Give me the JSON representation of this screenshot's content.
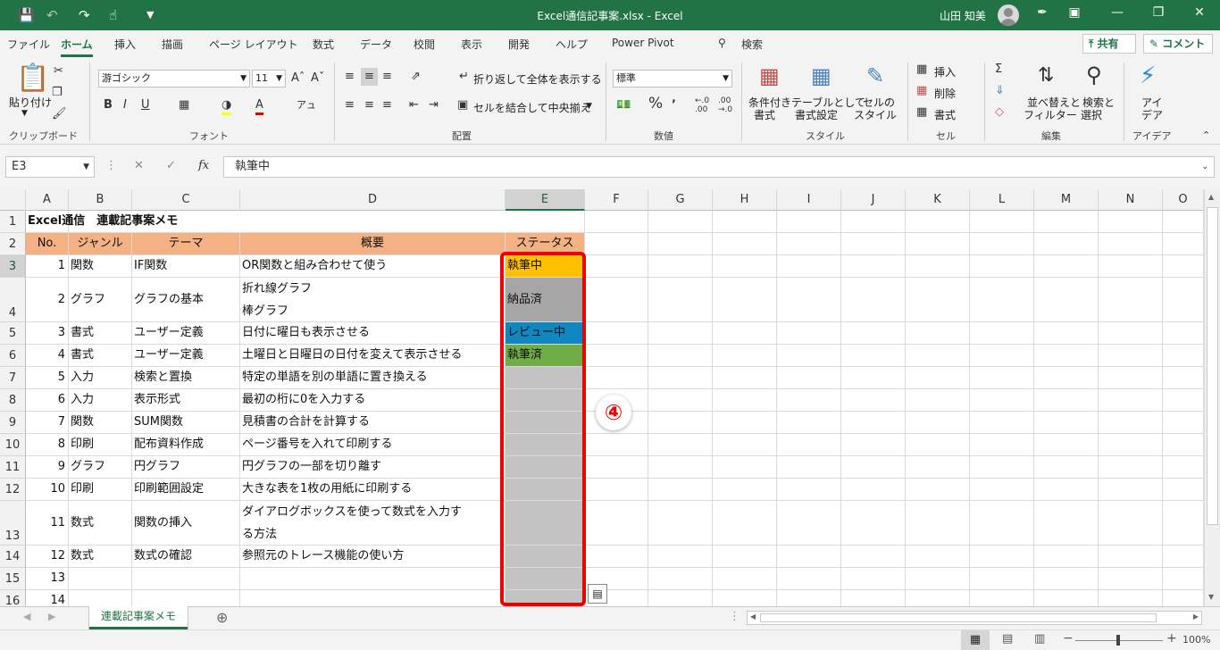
{
  "titlebar": {
    "title": "Excel通信記事案.xlsx  -  Excel",
    "user": "山田 知美"
  },
  "menu": {
    "tabs": [
      "ファイル",
      "ホーム",
      "挿入",
      "描画",
      "ページ レイアウト",
      "数式",
      "データ",
      "校閲",
      "表示",
      "開発",
      "ヘルプ",
      "Power Pivot"
    ],
    "search": "検索",
    "share": "共有",
    "comment": "コメント"
  },
  "ribbon": {
    "clipboard": {
      "paste": "貼り付け",
      "label": "クリップボード"
    },
    "font": {
      "name": "游ゴシック",
      "size": "11",
      "label": "フォント"
    },
    "align": {
      "wrap": "折り返して全体を表示する",
      "merge": "セルを結合して中央揃え",
      "label": "配置"
    },
    "number": {
      "format": "標準",
      "label": "数値"
    },
    "styles": {
      "cond1": "条件付き",
      "cond2": "書式",
      "table1": "テーブルとして",
      "table2": "書式設定",
      "cell1": "セルの",
      "cell2": "スタイル",
      "label": "スタイル"
    },
    "cells": {
      "insert": "挿入",
      "delete": "削除",
      "format": "書式",
      "label": "セル"
    },
    "edit": {
      "sort1": "並べ替えと",
      "sort2": "フィルター",
      "find1": "検索と",
      "find2": "選択",
      "label": "編集"
    },
    "ideas": {
      "l1": "アイ",
      "l2": "デア",
      "label": "アイデア"
    }
  },
  "formula": {
    "namebox": "E3",
    "fx": "fx",
    "value": "執筆中"
  },
  "columns": [
    "A",
    "B",
    "C",
    "D",
    "E",
    "F",
    "G",
    "H",
    "I",
    "J",
    "K",
    "L",
    "M",
    "N",
    "O"
  ],
  "rows": [
    "1",
    "2",
    "3",
    "4",
    "5",
    "6",
    "7",
    "8",
    "9",
    "10",
    "11",
    "12",
    "13",
    "14",
    "15",
    "16"
  ],
  "sheet": {
    "title": "Excel通信　連載記事案メモ",
    "headers": {
      "no": "No.",
      "genre": "ジャンル",
      "theme": "テーマ",
      "summary": "概要",
      "status": "ステータス"
    },
    "data": [
      {
        "no": "1",
        "genre": "関数",
        "theme": "IF関数",
        "summary": [
          "OR関数と組み合わせて使う"
        ],
        "status": "執筆中",
        "color": "#ffc000"
      },
      {
        "no": "2",
        "genre": "グラフ",
        "theme": "グラフの基本",
        "summary": [
          "折れ線グラフ",
          "棒グラフ"
        ],
        "status": "納品済",
        "color": "#a6a6a6"
      },
      {
        "no": "3",
        "genre": "書式",
        "theme": "ユーザー定義",
        "summary": [
          "日付に曜日も表示させる"
        ],
        "status": "レビュー中",
        "color": "#0f87c0"
      },
      {
        "no": "4",
        "genre": "書式",
        "theme": "ユーザー定義",
        "summary": [
          "土曜日と日曜日の日付を変えて表示させる"
        ],
        "status": "執筆済",
        "color": "#70ad47"
      },
      {
        "no": "5",
        "genre": "入力",
        "theme": "検索と置換",
        "summary": [
          "特定の単語を別の単語に置き換える"
        ],
        "status": "",
        "color": "#c3c3c3"
      },
      {
        "no": "6",
        "genre": "入力",
        "theme": "表示形式",
        "summary": [
          "最初の桁に0を入力する"
        ],
        "status": "",
        "color": "#c3c3c3"
      },
      {
        "no": "7",
        "genre": "関数",
        "theme": "SUM関数",
        "summary": [
          "見積書の合計を計算する"
        ],
        "status": "",
        "color": "#c3c3c3"
      },
      {
        "no": "8",
        "genre": "印刷",
        "theme": "配布資料作成",
        "summary": [
          "ページ番号を入れて印刷する"
        ],
        "status": "",
        "color": "#c3c3c3"
      },
      {
        "no": "9",
        "genre": "グラフ",
        "theme": "円グラフ",
        "summary": [
          "円グラフの一部を切り離す"
        ],
        "status": "",
        "color": "#c3c3c3"
      },
      {
        "no": "10",
        "genre": "印刷",
        "theme": "印刷範囲設定",
        "summary": [
          "大きな表を1枚の用紙に印刷する"
        ],
        "status": "",
        "color": "#c3c3c3"
      },
      {
        "no": "11",
        "genre": "数式",
        "theme": "関数の挿入",
        "summary": [
          "ダイアログボックスを使って数式を入力す",
          "る方法"
        ],
        "status": "",
        "color": "#c3c3c3"
      },
      {
        "no": "12",
        "genre": "数式",
        "theme": "数式の確認",
        "summary": [
          "参照元のトレース機能の使い方"
        ],
        "status": "",
        "color": "#c3c3c3"
      },
      {
        "no": "13",
        "genre": "",
        "theme": "",
        "summary": [
          ""
        ],
        "status": "",
        "color": "#c3c3c3"
      },
      {
        "no": "14",
        "genre": "",
        "theme": "",
        "summary": [
          ""
        ],
        "status": "",
        "color": "#c3c3c3"
      }
    ]
  },
  "annotation": {
    "marker": "④"
  },
  "tabs": {
    "sheet": "連載記事案メモ"
  },
  "status": {
    "zoom": "100%"
  },
  "colors": {
    "accent": "#217346",
    "header_fill": "#f4b183",
    "callout": "#ee0000"
  }
}
